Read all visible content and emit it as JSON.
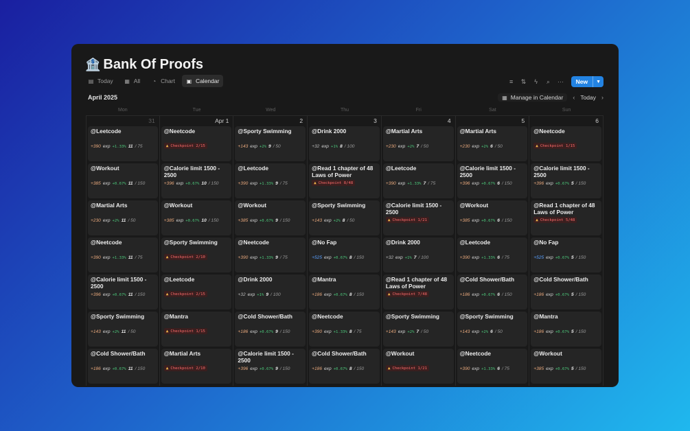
{
  "title": {
    "emoji": "🏦",
    "text": "Bank Of Proofs"
  },
  "views": [
    {
      "icon": "▤",
      "label": "Today",
      "active": false
    },
    {
      "icon": "▦",
      "label": "All",
      "active": false
    },
    {
      "icon": "◔",
      "label": "Chart",
      "active": false
    },
    {
      "icon": "▣",
      "label": "Calendar",
      "active": true
    }
  ],
  "toolbar": {
    "new_label": "New"
  },
  "calendar": {
    "month_label": "April 2025",
    "manage_label": "Manage in Calendar",
    "today_label": "Today",
    "weekdays": [
      "Mon",
      "Tue",
      "Wed",
      "Thu",
      "Fri",
      "Sat",
      "Sun"
    ],
    "days": [
      {
        "num": "31",
        "muted": true,
        "cards": [
          {
            "name": "@Leetcode",
            "exp": "+390",
            "pct": "+1.33%",
            "count": "11",
            "total": "/ 75"
          },
          {
            "name": "@Workout",
            "exp": "+385",
            "pct": "+0.67%",
            "count": "11",
            "total": "/ 150"
          },
          {
            "name": "@Martial Arts",
            "exp": "+230",
            "pct": "+2%",
            "count": "11",
            "total": "/ 50"
          },
          {
            "name": "@Neetcode",
            "exp": "+390",
            "pct": "+1.33%",
            "count": "11",
            "total": "/ 75"
          },
          {
            "name": "@Calorie limit 1500 - 2500",
            "exp": "+396",
            "pct": "+0.67%",
            "count": "11",
            "total": "/ 150"
          },
          {
            "name": "@Sporty Swimming",
            "exp": "+143",
            "pct": "+2%",
            "count": "11",
            "total": "/ 50"
          },
          {
            "name": "@Cold Shower/Bath",
            "exp": "+186",
            "pct": "+0.67%",
            "count": "11",
            "total": "/ 150"
          }
        ]
      },
      {
        "num": "Apr 1",
        "muted": false,
        "cards": [
          {
            "name": "@Neetcode",
            "checkpoint": "Checkpoint 2/15"
          },
          {
            "name": "@Calorie limit 1500 - 2500",
            "exp": "+396",
            "pct": "+0.67%",
            "count": "10",
            "total": "/ 150"
          },
          {
            "name": "@Workout",
            "exp": "+385",
            "pct": "+0.67%",
            "count": "10",
            "total": "/ 150"
          },
          {
            "name": "@Sporty Swimming",
            "checkpoint": "Checkpoint 2/10"
          },
          {
            "name": "@Leetcode",
            "checkpoint": "Checkpoint 2/15"
          },
          {
            "name": "@Mantra",
            "checkpoint": "Checkpoint 1/15"
          },
          {
            "name": "@Martial Arts",
            "checkpoint": "Checkpoint 2/10"
          }
        ]
      },
      {
        "num": "2",
        "muted": false,
        "cards": [
          {
            "name": "@Sporty Swimming",
            "exp": "+143",
            "pct": "+2%",
            "count": "9",
            "total": "/ 50"
          },
          {
            "name": "@Leetcode",
            "exp": "+390",
            "pct": "+1.33%",
            "count": "9",
            "total": "/ 75"
          },
          {
            "name": "@Workout",
            "exp": "+385",
            "pct": "+0.67%",
            "count": "9",
            "total": "/ 150"
          },
          {
            "name": "@Neetcode",
            "exp": "+390",
            "pct": "+1.33%",
            "count": "9",
            "total": "/ 75"
          },
          {
            "name": "@Drink 2000",
            "exp": "+32",
            "expcolor": "gray",
            "pct": "+1%",
            "count": "9",
            "total": "/ 100"
          },
          {
            "name": "@Cold Shower/Bath",
            "exp": "+186",
            "pct": "+0.67%",
            "count": "9",
            "total": "/ 150"
          },
          {
            "name": "@Calorie limit 1500 - 2500",
            "exp": "+396",
            "pct": "+0.67%",
            "count": "9",
            "total": "/ 150"
          }
        ]
      },
      {
        "num": "3",
        "muted": false,
        "cards": [
          {
            "name": "@Drink 2000",
            "exp": "+32",
            "expcolor": "gray",
            "pct": "+1%",
            "count": "8",
            "total": "/ 100"
          },
          {
            "name": "@Read 1 chapter of 48 Laws of Power",
            "checkpoint": "Checkpoint 8/48"
          },
          {
            "name": "@Sporty Swimming",
            "exp": "+143",
            "pct": "+2%",
            "count": "8",
            "total": "/ 50"
          },
          {
            "name": "@No Fap",
            "exp": "+525",
            "expcolor": "blue",
            "pct": "+0.67%",
            "count": "8",
            "total": "/ 150"
          },
          {
            "name": "@Mantra",
            "exp": "+186",
            "pct": "+0.67%",
            "count": "8",
            "total": "/ 150"
          },
          {
            "name": "@Neetcode",
            "exp": "+390",
            "pct": "+1.33%",
            "count": "8",
            "total": "/ 75"
          },
          {
            "name": "@Cold Shower/Bath",
            "exp": "+186",
            "pct": "+0.67%",
            "count": "8",
            "total": "/ 150"
          }
        ]
      },
      {
        "num": "4",
        "muted": false,
        "cards": [
          {
            "name": "@Martial Arts",
            "exp": "+230",
            "pct": "+2%",
            "count": "7",
            "total": "/ 50"
          },
          {
            "name": "@Leetcode",
            "exp": "+390",
            "pct": "+1.33%",
            "count": "7",
            "total": "/ 75"
          },
          {
            "name": "@Calorie limit 1500 - 2500",
            "checkpoint": "Checkpoint 1/21"
          },
          {
            "name": "@Drink 2000",
            "exp": "+32",
            "expcolor": "gray",
            "pct": "+1%",
            "count": "7",
            "total": "/ 100"
          },
          {
            "name": "@Read 1 chapter of 48 Laws of Power",
            "checkpoint": "Checkpoint 7/48"
          },
          {
            "name": "@Sporty Swimming",
            "exp": "+143",
            "pct": "+2%",
            "count": "7",
            "total": "/ 50"
          },
          {
            "name": "@Workout",
            "checkpoint": "Checkpoint 1/21"
          }
        ]
      },
      {
        "num": "5",
        "muted": false,
        "cards": [
          {
            "name": "@Martial Arts",
            "exp": "+230",
            "pct": "+2%",
            "count": "6",
            "total": "/ 50"
          },
          {
            "name": "@Calorie limit 1500 - 2500",
            "exp": "+396",
            "pct": "+0.67%",
            "count": "6",
            "total": "/ 150"
          },
          {
            "name": "@Workout",
            "exp": "+385",
            "pct": "+0.67%",
            "count": "6",
            "total": "/ 150"
          },
          {
            "name": "@Leetcode",
            "exp": "+390",
            "pct": "+1.33%",
            "count": "6",
            "total": "/ 75"
          },
          {
            "name": "@Cold Shower/Bath",
            "exp": "+186",
            "pct": "+0.67%",
            "count": "6",
            "total": "/ 150"
          },
          {
            "name": "@Sporty Swimming",
            "exp": "+143",
            "pct": "+2%",
            "count": "6",
            "total": "/ 50"
          },
          {
            "name": "@Neetcode",
            "exp": "+390",
            "pct": "+1.33%",
            "count": "6",
            "total": "/ 75"
          }
        ]
      },
      {
        "num": "6",
        "muted": false,
        "cards": [
          {
            "name": "@Neetcode",
            "checkpoint": "Checkpoint 1/15"
          },
          {
            "name": "@Calorie limit 1500 - 2500",
            "exp": "+396",
            "pct": "+0.67%",
            "count": "5",
            "total": "/ 150"
          },
          {
            "name": "@Read 1 chapter of 48 Laws of Power",
            "checkpoint": "Checkpoint 5/48"
          },
          {
            "name": "@No Fap",
            "exp": "+525",
            "expcolor": "blue",
            "pct": "+0.67%",
            "count": "5",
            "total": "/ 150"
          },
          {
            "name": "@Cold Shower/Bath",
            "exp": "+186",
            "pct": "+0.67%",
            "count": "5",
            "total": "/ 150"
          },
          {
            "name": "@Mantra",
            "exp": "+186",
            "pct": "+0.67%",
            "count": "5",
            "total": "/ 150"
          },
          {
            "name": "@Workout",
            "exp": "+385",
            "pct": "+0.67%",
            "count": "5",
            "total": "/ 150"
          }
        ]
      }
    ]
  },
  "exp_unit": "exp"
}
